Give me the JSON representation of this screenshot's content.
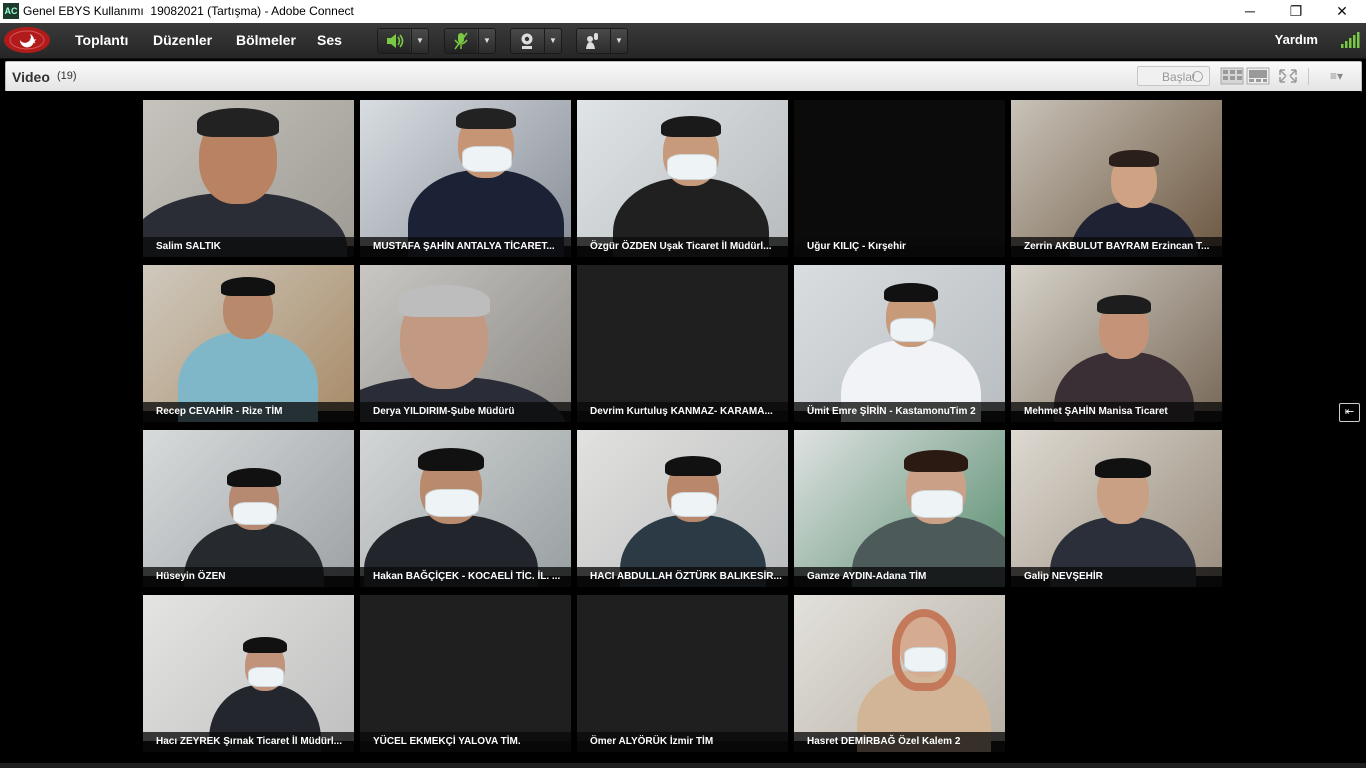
{
  "window": {
    "title": "Genel EBYS Kullanımı  19082021 (Tartışma) - Adobe Connect",
    "app_icon_text": "AC",
    "controls": {
      "minimize": "─",
      "maximize": "❐",
      "close": "✕"
    }
  },
  "menubar": {
    "items": [
      "Toplantı",
      "Düzenler",
      "Bölmeler",
      "Ses"
    ],
    "help": "Yardım",
    "icons": [
      "speaker-icon",
      "microphone-icon",
      "webcam-icon",
      "raise-hand-icon"
    ],
    "accent_color": "#7ac943"
  },
  "pod": {
    "title": "Video",
    "count": "(19)",
    "start_button": "Başlat",
    "menu_glyph": "≡▾"
  },
  "side_button_glyph": "⇤",
  "participants": [
    {
      "name": "Salim SALTIK",
      "video": true
    },
    {
      "name": "MUSTAFA ŞAHİN ANTALYA TİCARET...",
      "video": true
    },
    {
      "name": "Özgür ÖZDEN Uşak Ticaret İl Müdürl...",
      "video": true
    },
    {
      "name": "Uğur KILIÇ - Kırşehir",
      "video": false
    },
    {
      "name": "Zerrin AKBULUT BAYRAM Erzincan T...",
      "video": true
    },
    {
      "name": "Recep CEVAHİR - Rize TİM",
      "video": true
    },
    {
      "name": "Derya YILDIRIM-Şube Müdürü",
      "video": true
    },
    {
      "name": "Devrim Kurtuluş KANMAZ- KARAMA...",
      "video": false
    },
    {
      "name": "Ümit Emre ŞİRİN - KastamonuTim 2",
      "video": true
    },
    {
      "name": "Mehmet ŞAHİN Manisa Ticaret",
      "video": true
    },
    {
      "name": "Hüseyin ÖZEN",
      "video": true
    },
    {
      "name": "Hakan BAĞÇİÇEK - KOCAELİ TİC. İL. ...",
      "video": true
    },
    {
      "name": "HACI ABDULLAH ÖZTÜRK BALIKESİR...",
      "video": true
    },
    {
      "name": "Gamze  AYDIN-Adana TİM",
      "video": true
    },
    {
      "name": "Galip NEVŞEHİR",
      "video": true
    },
    {
      "name": "Hacı ZEYREK Şırnak Ticaret İl Müdürl...",
      "video": true
    },
    {
      "name": "YÜCEL EKMEKÇİ YALOVA TİM.",
      "video": false
    },
    {
      "name": "Ömer ALYÖRÜK İzmir TİM",
      "video": false
    },
    {
      "name": "Hasret DEMİRBAĞ Özel Kalem 2",
      "video": true
    }
  ]
}
